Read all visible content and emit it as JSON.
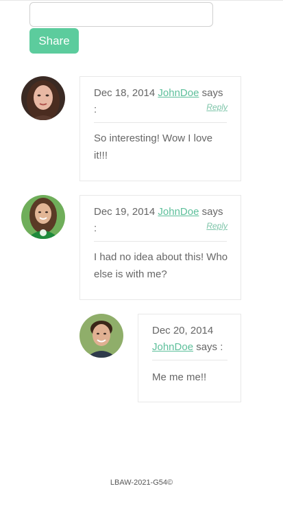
{
  "form": {
    "input_value": "",
    "share_label": "Share"
  },
  "comments": [
    {
      "date": "Dec 18, 2014",
      "author": "JohnDoe",
      "says": "says :",
      "reply": "Reply",
      "text": "So interesting! Wow I love it!!!"
    },
    {
      "date": "Dec 19, 2014",
      "author": "JohnDoe",
      "says": "says :",
      "reply": "Reply",
      "text": "I had no idea about this! Who else is with me?"
    },
    {
      "date": "Dec 20, 2014",
      "author": "JohnDoe",
      "says": "says :",
      "text": "Me me me!!"
    }
  ],
  "footer": {
    "text": "LBAW-2021-G54©"
  },
  "colors": {
    "accent": "#5ccc9d",
    "link": "#5cbf9a"
  }
}
